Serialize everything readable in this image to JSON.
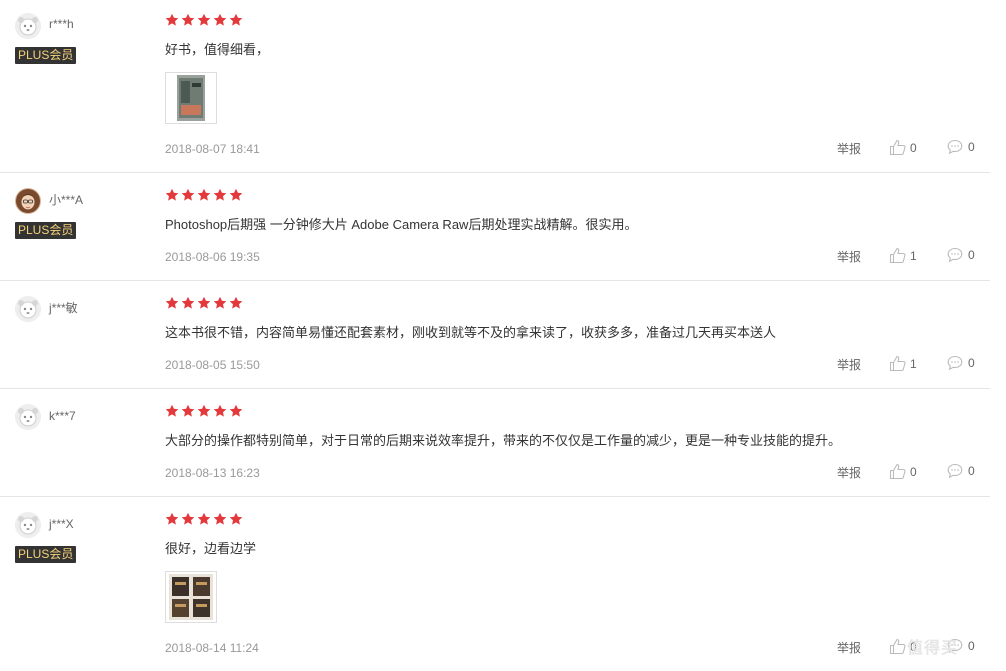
{
  "colors": {
    "star": "#e4393c",
    "plus_bg": "#333333",
    "plus_text": "#f5d27a"
  },
  "reviews": [
    {
      "user": "r***h",
      "avatar": "default-avatar",
      "plus": "PLUS会员",
      "stars": 5,
      "text": "好书，值得细看，",
      "has_image": true,
      "date": "2018-08-07 18:41",
      "report": "举报",
      "likes": "0",
      "replies": "0"
    },
    {
      "user": "小***A",
      "avatar": "photo-avatar",
      "plus": "PLUS会员",
      "stars": 5,
      "text": "Photoshop后期强 一分钟修大片 Adobe Camera Raw后期处理实战精解。很实用。",
      "has_image": false,
      "date": "2018-08-06 19:35",
      "report": "举报",
      "likes": "1",
      "replies": "0"
    },
    {
      "user": "j***敏",
      "avatar": "default-avatar",
      "plus": "",
      "stars": 5,
      "text": "这本书很不错，内容简单易懂还配套素材，刚收到就等不及的拿来读了，收获多多，准备过几天再买本送人",
      "has_image": false,
      "date": "2018-08-05 15:50",
      "report": "举报",
      "likes": "1",
      "replies": "0"
    },
    {
      "user": "k***7",
      "avatar": "default-avatar",
      "plus": "",
      "stars": 5,
      "text": "大部分的操作都特别简单，对于日常的后期来说效率提升，带来的不仅仅是工作量的减少，更是一种专业技能的提升。",
      "has_image": false,
      "date": "2018-08-13 16:23",
      "report": "举报",
      "likes": "0",
      "replies": "0"
    },
    {
      "user": "j***X",
      "avatar": "default-avatar",
      "plus": "PLUS会员",
      "stars": 5,
      "text": "很好，边看边学",
      "has_image": true,
      "date": "2018-08-14 11:24",
      "report": "举报",
      "likes": "0",
      "replies": "0"
    }
  ],
  "watermark": "值得买"
}
